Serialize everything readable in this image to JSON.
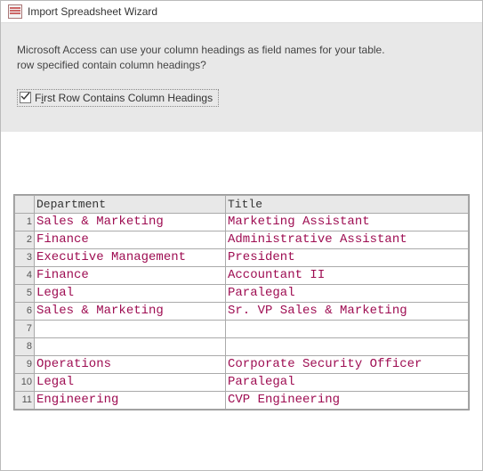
{
  "titlebar": {
    "title": "Import Spreadsheet Wizard"
  },
  "instructions": {
    "line1": "Microsoft Access can use your column headings as field names for your table.",
    "line2": "row specified contain column headings?"
  },
  "checkbox": {
    "checked": true,
    "label_pre": "F",
    "label_u": "i",
    "label_post": "rst Row Contains Column Headings"
  },
  "grid": {
    "headers": {
      "rownum": "",
      "department": "Department",
      "title": "Title"
    },
    "rows": [
      {
        "n": "1",
        "dept": "Sales & Marketing",
        "title": "Marketing Assistant"
      },
      {
        "n": "2",
        "dept": "Finance",
        "title": "Administrative Assistant"
      },
      {
        "n": "3",
        "dept": "Executive Management",
        "title": "President"
      },
      {
        "n": "4",
        "dept": "Finance",
        "title": "Accountant II"
      },
      {
        "n": "5",
        "dept": "Legal",
        "title": "Paralegal"
      },
      {
        "n": "6",
        "dept": "Sales & Marketing",
        "title": "Sr. VP Sales & Marketing"
      },
      {
        "n": "7",
        "dept": "",
        "title": ""
      },
      {
        "n": "8",
        "dept": "",
        "title": ""
      },
      {
        "n": "9",
        "dept": "Operations",
        "title": "Corporate Security Officer"
      },
      {
        "n": "10",
        "dept": "Legal",
        "title": "Paralegal"
      },
      {
        "n": "11",
        "dept": "Engineering",
        "title": "CVP Engineering"
      }
    ]
  }
}
